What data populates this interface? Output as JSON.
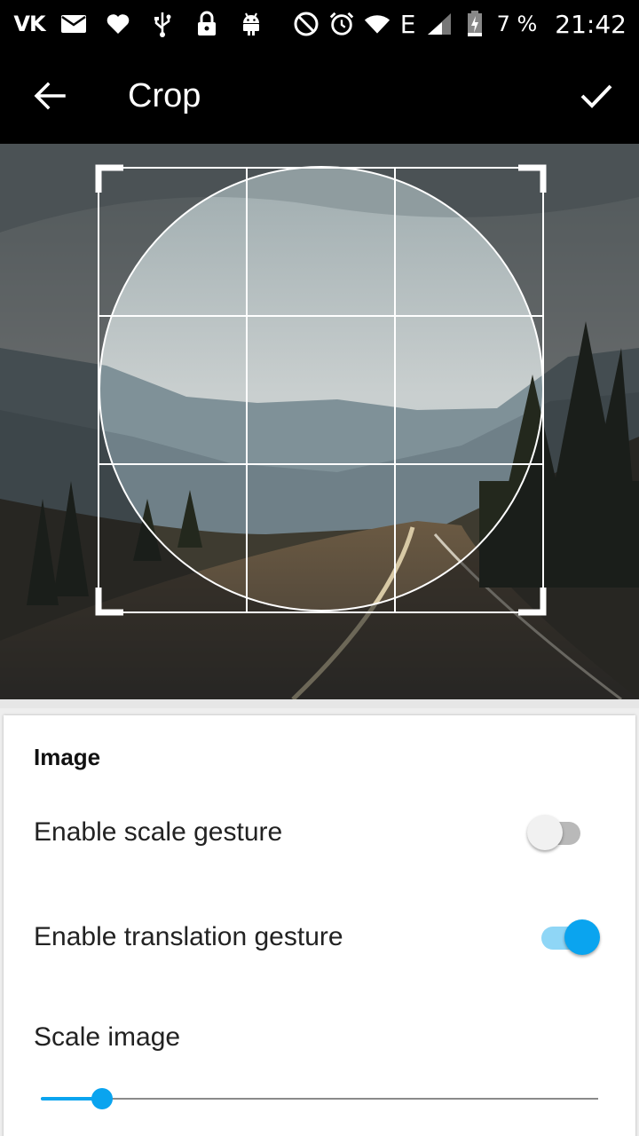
{
  "status_bar": {
    "left_icons": [
      "vk-icon",
      "mail-icon",
      "heart-icon",
      "usb-icon",
      "lock-icon",
      "android-icon"
    ],
    "vk_text": "VK",
    "right_icons": [
      "do-not-disturb-icon",
      "alarm-icon",
      "wifi-icon",
      "signal-icon",
      "battery-charging-icon"
    ],
    "network_type": "E",
    "battery_percent": "7 %",
    "time": "21:42"
  },
  "app_bar": {
    "title": "Crop",
    "back_icon": "arrow-back-icon",
    "confirm_icon": "check-icon"
  },
  "crop": {
    "shape": "circle",
    "grid": "3x3"
  },
  "settings": {
    "section_title": "Image",
    "scale_gesture": {
      "label": "Enable scale gesture",
      "enabled": false
    },
    "translation_gesture": {
      "label": "Enable translation gesture",
      "enabled": true
    },
    "scale_image": {
      "label": "Scale image",
      "value_fraction": 0.11
    }
  },
  "colors": {
    "accent": "#0aa4ef",
    "accent_light": "#8fd6f6",
    "bar_background": "#000000"
  }
}
